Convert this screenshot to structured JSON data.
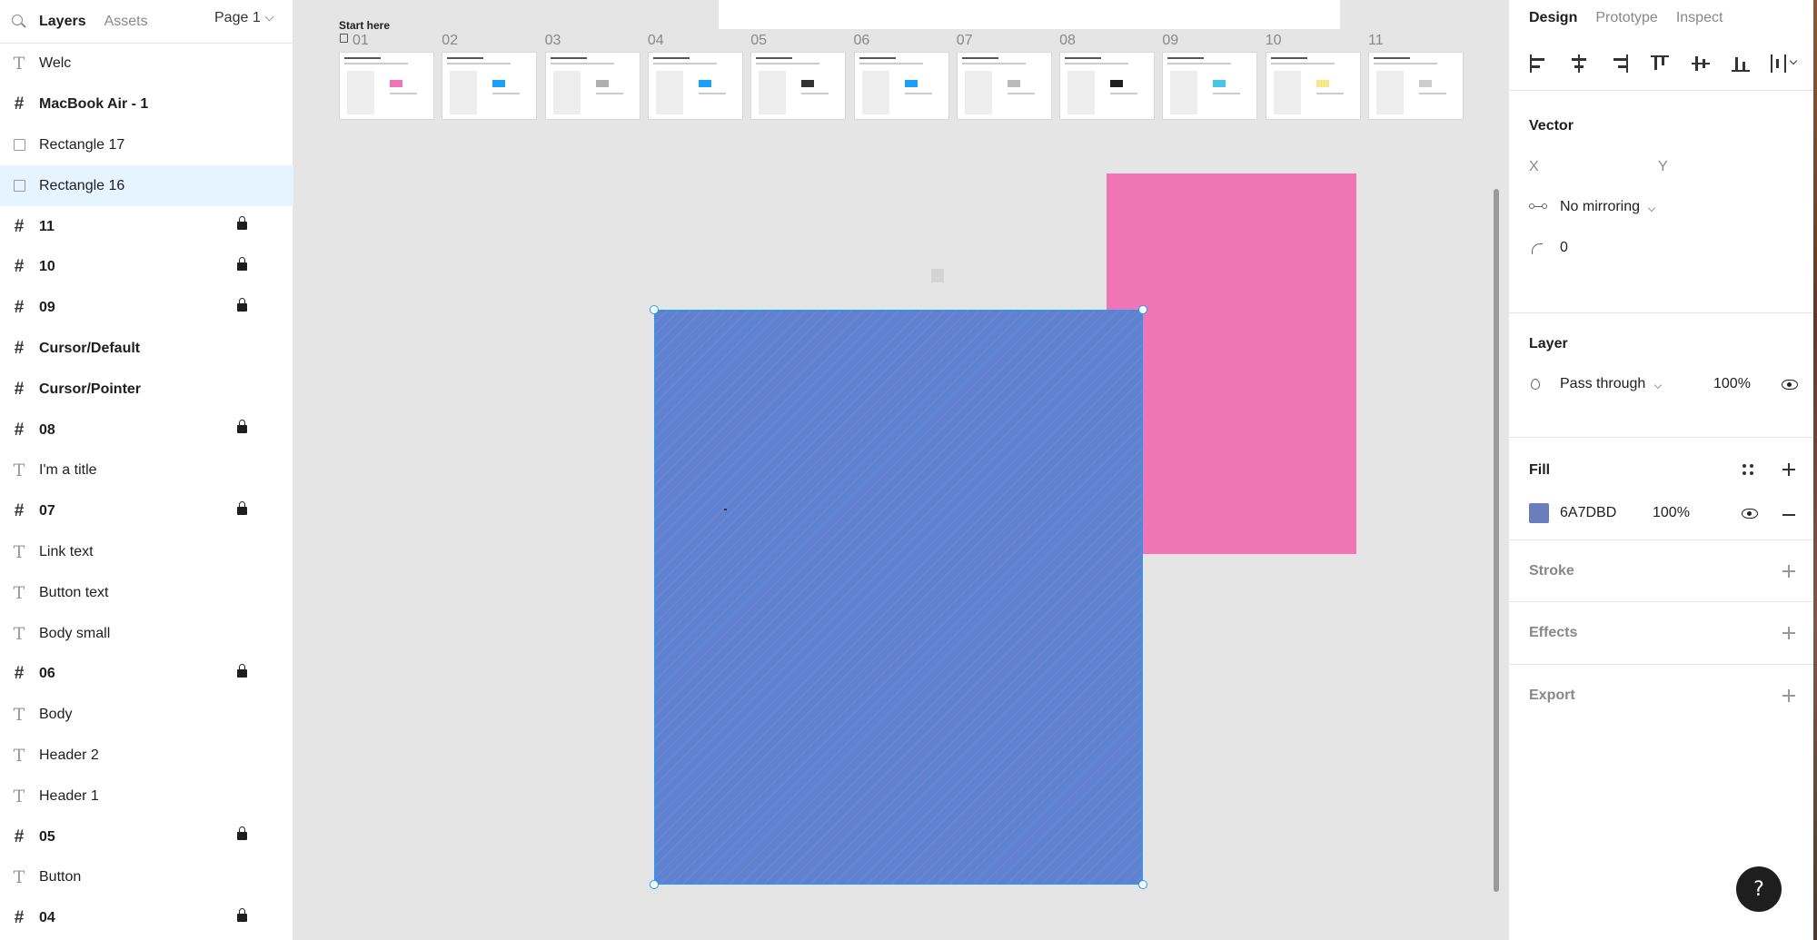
{
  "left_panel": {
    "tab_layers": "Layers",
    "tab_assets": "Assets",
    "page_select": "Page 1",
    "layers": [
      {
        "name": "Welc",
        "icon": "text-icon",
        "bold": false,
        "locked": false,
        "selected": false
      },
      {
        "name": "MacBook Air - 1",
        "icon": "frame-icon",
        "bold": true,
        "locked": false,
        "selected": false
      },
      {
        "name": "Rectangle 17",
        "icon": "rectangle-icon",
        "bold": false,
        "locked": false,
        "selected": false
      },
      {
        "name": "Rectangle 16",
        "icon": "rectangle-icon",
        "bold": false,
        "locked": false,
        "selected": true
      },
      {
        "name": "11",
        "icon": "frame-icon",
        "bold": true,
        "locked": true,
        "selected": false
      },
      {
        "name": "10",
        "icon": "frame-icon",
        "bold": true,
        "locked": true,
        "selected": false
      },
      {
        "name": "09",
        "icon": "frame-icon",
        "bold": true,
        "locked": true,
        "selected": false
      },
      {
        "name": "Cursor/Default",
        "icon": "frame-icon",
        "bold": true,
        "locked": false,
        "selected": false
      },
      {
        "name": "Cursor/Pointer",
        "icon": "frame-icon",
        "bold": true,
        "locked": false,
        "selected": false
      },
      {
        "name": "08",
        "icon": "frame-icon",
        "bold": true,
        "locked": true,
        "selected": false
      },
      {
        "name": "I'm a title",
        "icon": "text-icon",
        "bold": false,
        "locked": false,
        "selected": false
      },
      {
        "name": "07",
        "icon": "frame-icon",
        "bold": true,
        "locked": true,
        "selected": false
      },
      {
        "name": "Link text",
        "icon": "text-icon",
        "bold": false,
        "locked": false,
        "selected": false
      },
      {
        "name": "Button text",
        "icon": "text-icon",
        "bold": false,
        "locked": false,
        "selected": false
      },
      {
        "name": "Body small",
        "icon": "text-icon",
        "bold": false,
        "locked": false,
        "selected": false
      },
      {
        "name": "06",
        "icon": "frame-icon",
        "bold": true,
        "locked": true,
        "selected": false
      },
      {
        "name": "Body",
        "icon": "text-icon",
        "bold": false,
        "locked": false,
        "selected": false
      },
      {
        "name": "Header 2",
        "icon": "text-icon",
        "bold": false,
        "locked": false,
        "selected": false
      },
      {
        "name": "Header 1",
        "icon": "text-icon",
        "bold": false,
        "locked": false,
        "selected": false
      },
      {
        "name": "05",
        "icon": "frame-icon",
        "bold": true,
        "locked": true,
        "selected": false
      },
      {
        "name": "Button",
        "icon": "text-icon",
        "bold": false,
        "locked": false,
        "selected": false
      },
      {
        "name": "04",
        "icon": "frame-icon",
        "bold": true,
        "locked": true,
        "selected": false
      }
    ]
  },
  "canvas": {
    "start_here": "Start here",
    "thumbnails": [
      "01",
      "02",
      "03",
      "04",
      "05",
      "06",
      "07",
      "08",
      "09",
      "10",
      "11"
    ],
    "pink_color": "#f075b6",
    "blue_color": "#5c82d2"
  },
  "right_panel": {
    "tab_design": "Design",
    "tab_prototype": "Prototype",
    "tab_inspect": "Inspect",
    "vector": {
      "title": "Vector",
      "x_label": "X",
      "y_label": "Y",
      "mirroring": "No mirroring",
      "corner_radius": "0"
    },
    "layer": {
      "title": "Layer",
      "blend_mode": "Pass through",
      "opacity": "100%"
    },
    "fill": {
      "title": "Fill",
      "hex": "6A7DBD",
      "opacity": "100%",
      "color": "#6a7dbd"
    },
    "stroke_title": "Stroke",
    "effects_title": "Effects",
    "export_title": "Export"
  },
  "help_label": "?"
}
